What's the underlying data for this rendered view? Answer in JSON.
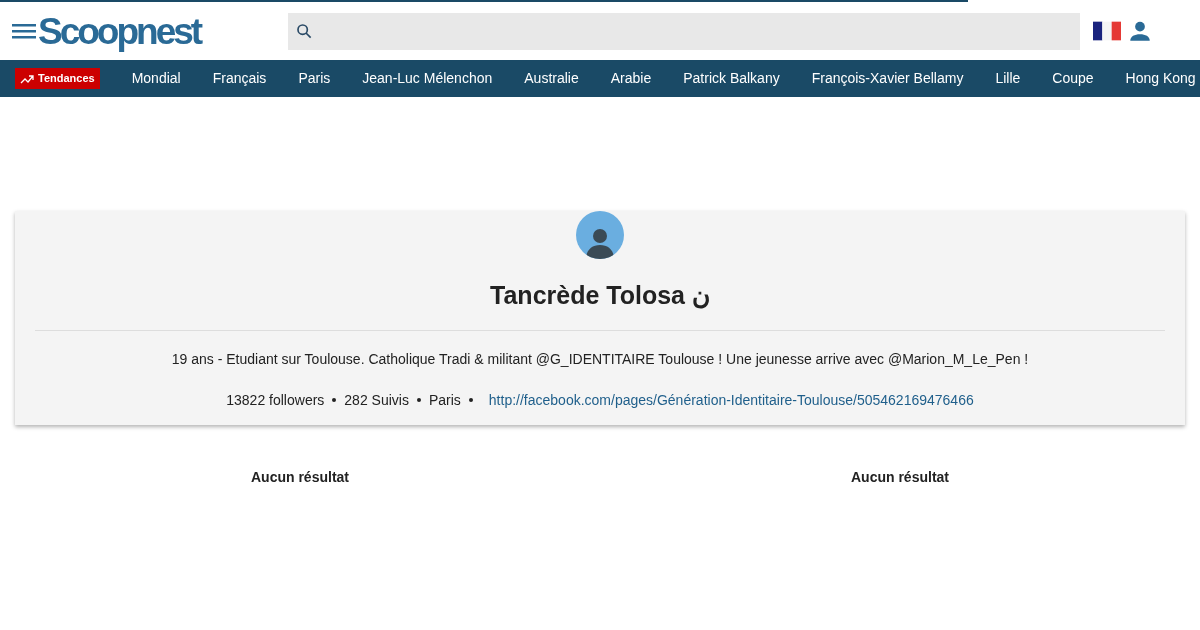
{
  "loading_bar": {
    "level": 0.807
  },
  "header": {
    "logo": "Scoopnest"
  },
  "trending": {
    "label": "Tendances",
    "items": [
      "Mondial",
      "Français",
      "Paris",
      "Jean-Luc Mélenchon",
      "Australie",
      "Arabie",
      "Patrick Balkany",
      "François-Xavier Bellamy",
      "Lille",
      "Coupe",
      "Hong Kong"
    ]
  },
  "profile": {
    "name": "Tancrède Tolosa ن",
    "bio": "19 ans - Etudiant sur Toulouse. Catholique Tradi & militant @G_IDENTITAIRE Toulouse ! Une jeunesse arrive avec @Marion_M_Le_Pen !",
    "stats": [
      "13822 followers",
      "282 Suivis",
      "Paris"
    ],
    "link": "http://facebook.com/pages/Génération-Identitaire-Toulouse/505462169476466"
  },
  "results": [
    "Aucun résultat",
    "Aucun résultat"
  ]
}
